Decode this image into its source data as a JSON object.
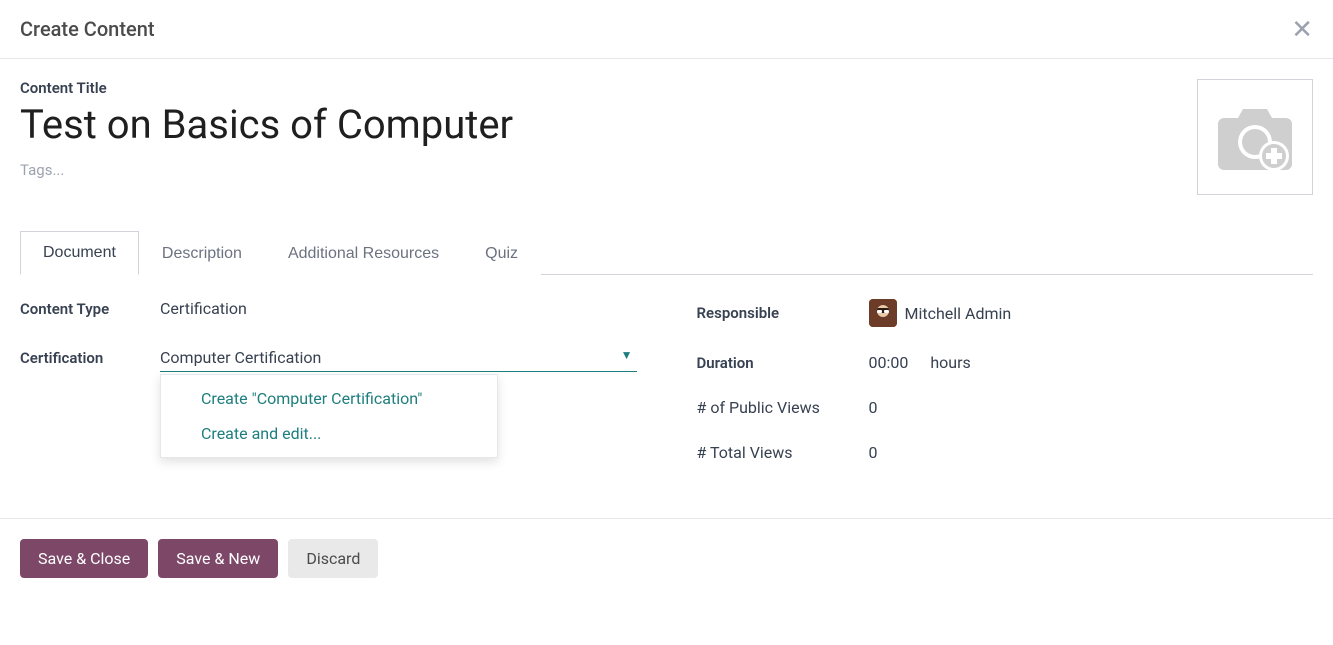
{
  "header": {
    "title": "Create Content"
  },
  "content": {
    "title_label": "Content Title",
    "title_value": "Test on Basics of Computer",
    "tags_placeholder": "Tags..."
  },
  "tabs": [
    {
      "label": "Document",
      "active": true
    },
    {
      "label": "Description",
      "active": false
    },
    {
      "label": "Additional Resources",
      "active": false
    },
    {
      "label": "Quiz",
      "active": false
    }
  ],
  "left_fields": {
    "content_type_label": "Content Type",
    "content_type_value": "Certification",
    "certification_label": "Certification",
    "certification_value": "Computer Certification"
  },
  "dropdown": {
    "create_label": "Create \"Computer Certification\"",
    "create_edit_label": "Create and edit..."
  },
  "right_fields": {
    "responsible_label": "Responsible",
    "responsible_value": "Mitchell Admin",
    "duration_label": "Duration",
    "duration_value": "00:00",
    "duration_unit": "hours",
    "public_views_label": "# of Public Views",
    "public_views_value": "0",
    "total_views_label": "# Total Views",
    "total_views_value": "0"
  },
  "footer": {
    "save_close": "Save & Close",
    "save_new": "Save & New",
    "discard": "Discard"
  }
}
